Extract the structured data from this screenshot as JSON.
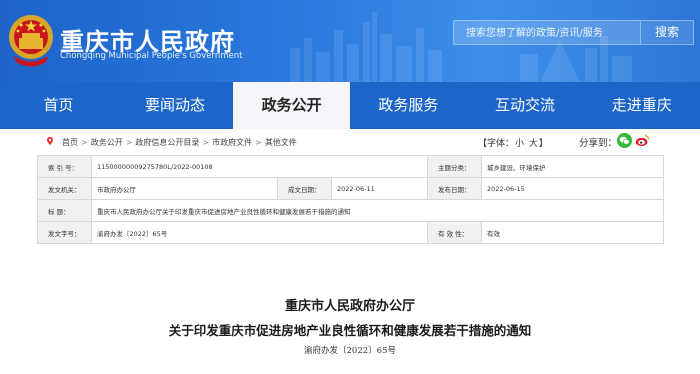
{
  "header": {
    "site_title": "重庆市人民政府",
    "site_subtitle": "Chongqing Municipal People's Government",
    "search_placeholder": "搜索您想了解的政策/资讯/服务",
    "search_button": "搜索",
    "banner_color": "#2b7be0"
  },
  "nav": {
    "items": [
      {
        "label": "首页"
      },
      {
        "label": "要闻动态"
      },
      {
        "label": "政务公开",
        "active": true
      },
      {
        "label": "政务服务"
      },
      {
        "label": "互动交流"
      },
      {
        "label": "走进重庆"
      }
    ],
    "active_color": "#f4f6f9"
  },
  "breadcrumb": {
    "items": [
      "首页",
      "政务公开",
      "政府信息公开目录",
      "市政府文件",
      "其他文件"
    ],
    "separator": ">",
    "font_label": "【字体：",
    "font_small": "小",
    "font_large": "大",
    "font_close": "】",
    "share_label": "分享到："
  },
  "info": {
    "index_no_label": "索 引 号：",
    "index_no": "11500000009275780L/2022-00108",
    "topic_label": "主题分类：",
    "topic": "城乡建设、环境保护",
    "issuer_label": "发文机关：",
    "issuer": "市政府办公厅",
    "written_label": "成文日期：",
    "written_date": "2022-06-11",
    "published_label": "发布日期：",
    "published_date": "2022-06-15",
    "title_label": "标    题：",
    "title": "重庆市人民政府办公厅关于印发重庆市促进房地产业良性循环和健康发展若干措施的通知",
    "docno_label": "发文字号：",
    "docno": "渝府办发〔2022〕65号",
    "validity_label": "有 效 性：",
    "validity": "有效"
  },
  "document": {
    "issuer": "重庆市人民政府办公厅",
    "title": "关于印发重庆市促进房地产业良性循环和健康发展若干措施的通知",
    "number": "渝府办发〔2022〕65号"
  }
}
